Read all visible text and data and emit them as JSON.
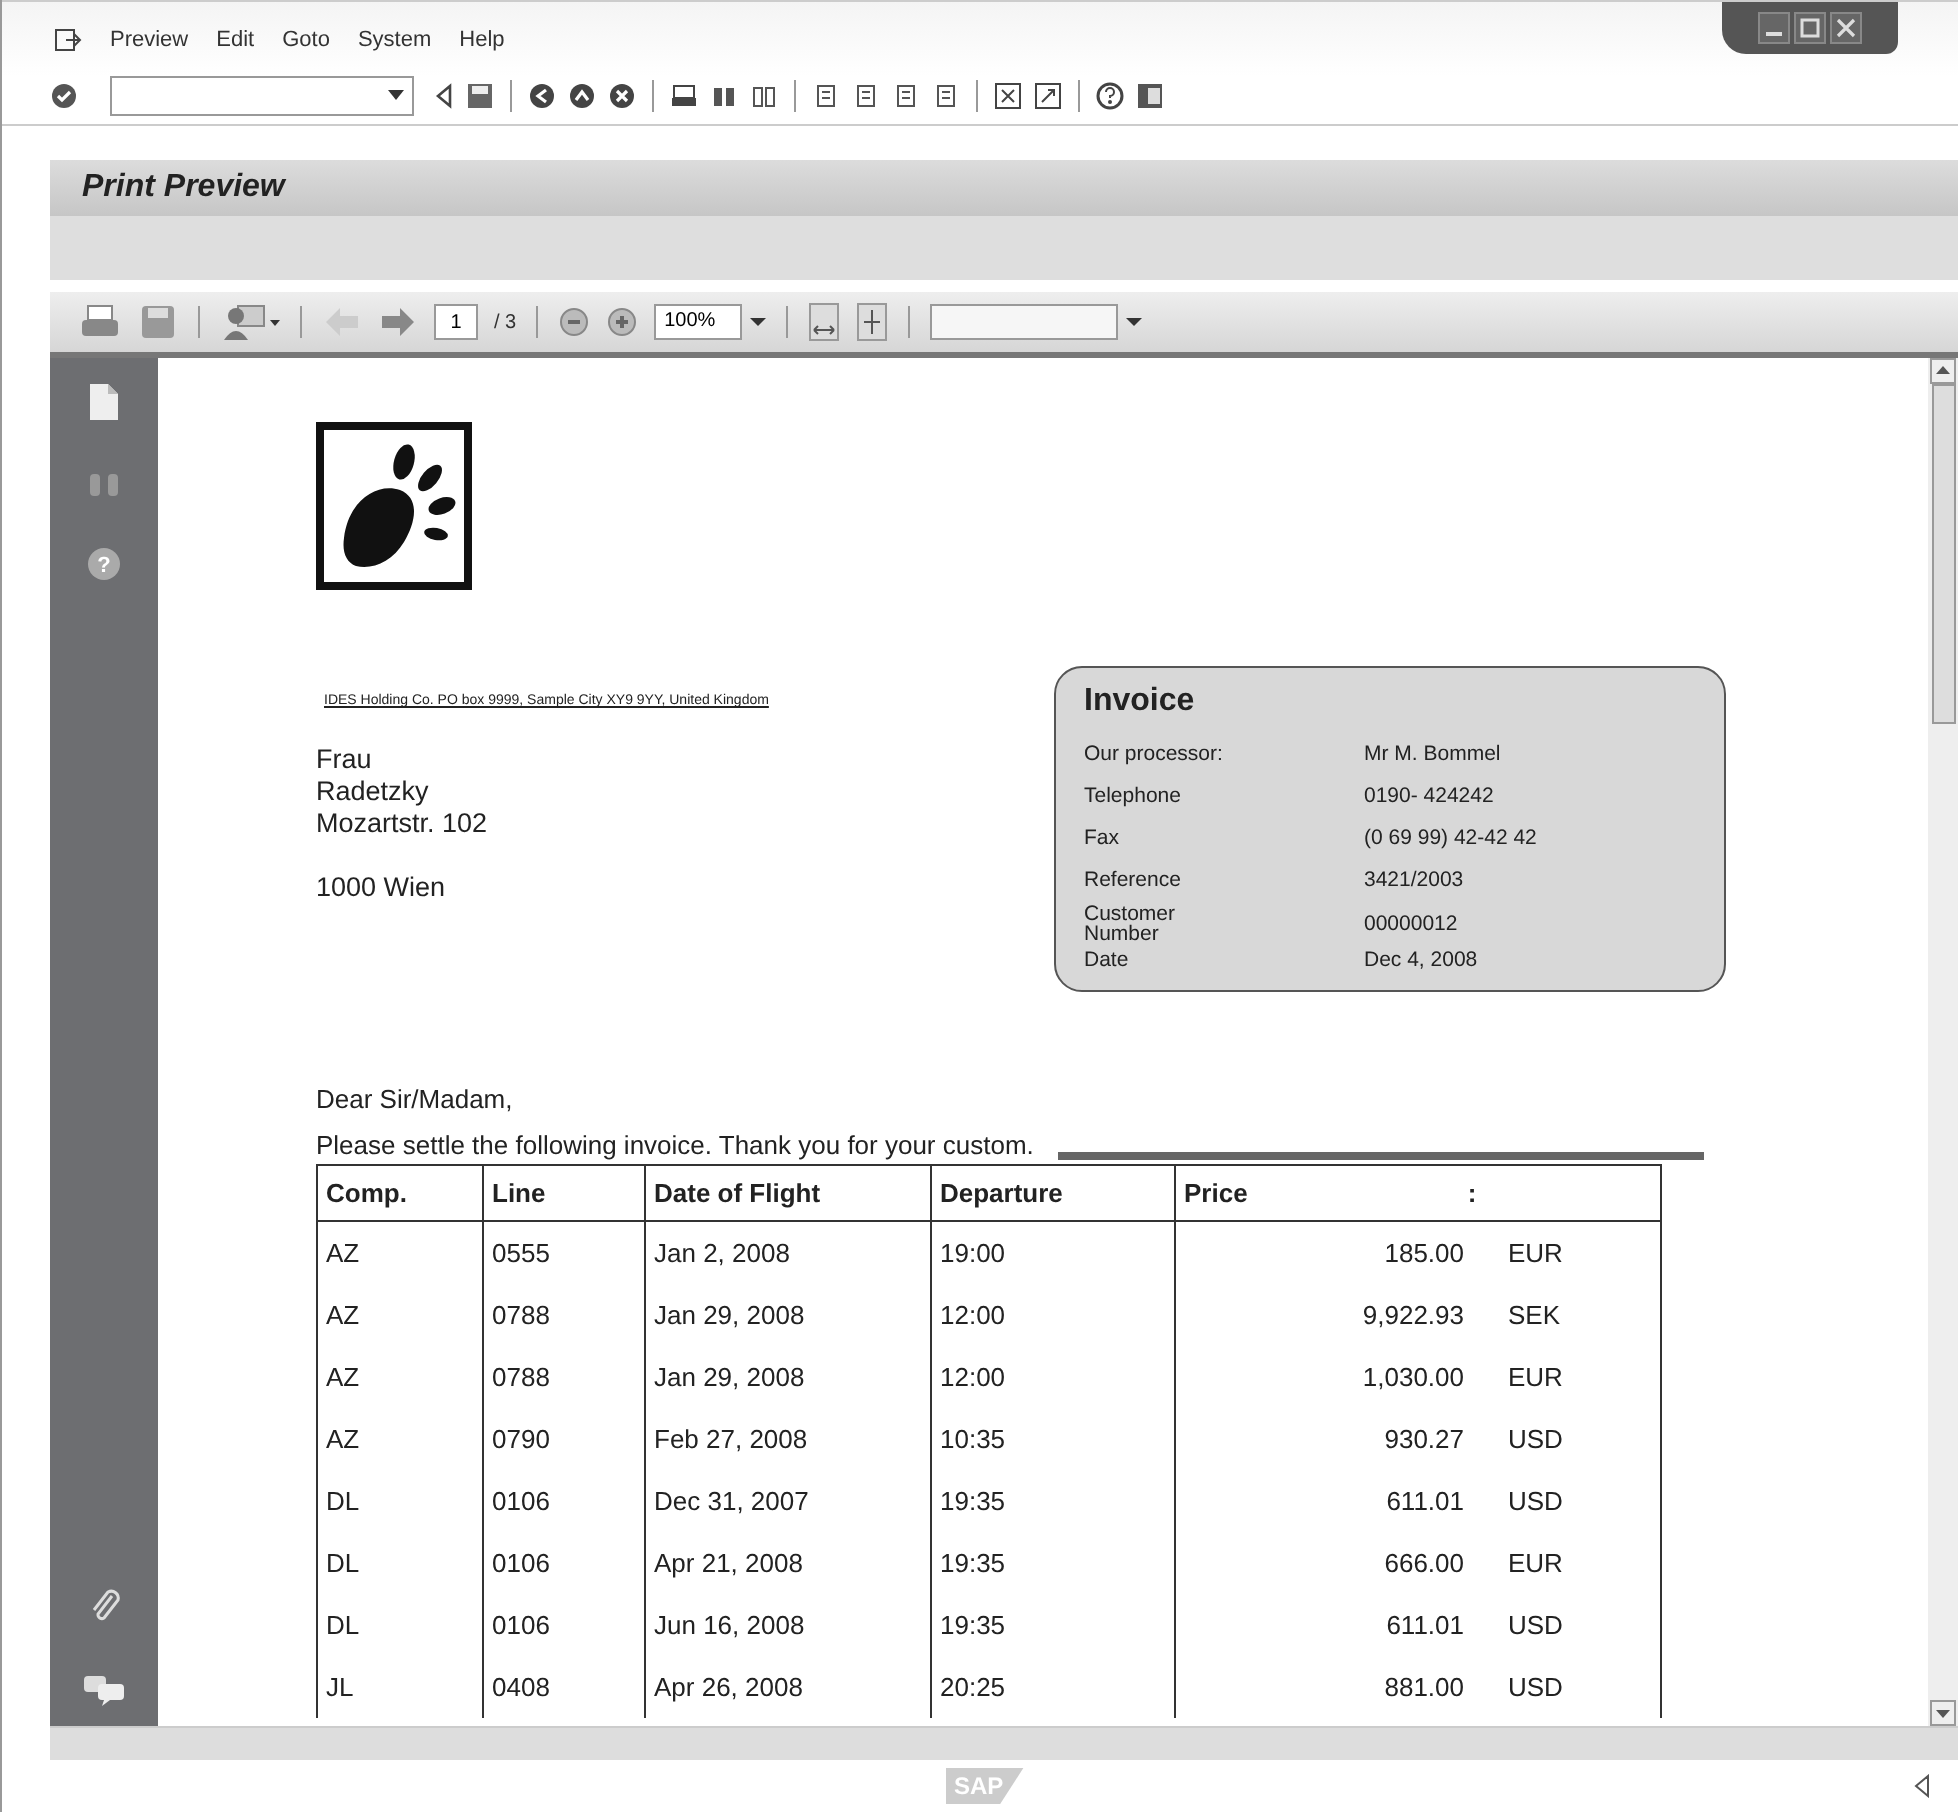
{
  "menu": [
    "Preview",
    "Edit",
    "Goto",
    "System",
    "Help"
  ],
  "screen_title": "Print Preview",
  "pdf_toolbar": {
    "page": "1",
    "page_total": "/ 3",
    "zoom": "100%"
  },
  "sidebar": {
    "help_glyph": "?"
  },
  "document": {
    "sender_line": "IDES Holding Co. PO box 9999, Sample City XY9 9YY, United Kingdom",
    "address": [
      "Frau",
      "Radetzky",
      "Mozartstr. 102"
    ],
    "city": "1000 Wien",
    "invoice": {
      "title": "Invoice",
      "fields": [
        {
          "label": "Our processor:",
          "value": "Mr M. Bommel"
        },
        {
          "label": "Telephone",
          "value": "0190- 424242"
        },
        {
          "label": "Fax",
          "value": "(0 69 99) 42-42 42"
        },
        {
          "label": "Reference",
          "value": "3421/2003"
        },
        {
          "label": "Customer Number",
          "value": "00000012"
        },
        {
          "label": "Date",
          "value": "Dec 4, 2008"
        }
      ]
    },
    "greeting": "Dear Sir/Madam,",
    "body": "Please settle the following invoice. Thank you for your custom.",
    "table": {
      "columns": [
        "Comp.",
        "Line",
        "Date of Flight",
        "Departure",
        "Price"
      ],
      "price_header_colon": ":",
      "rows": [
        {
          "comp": "AZ",
          "line": "0555",
          "date": "Jan 2, 2008",
          "departure": "19:00",
          "amount": "185.00",
          "currency": "EUR"
        },
        {
          "comp": "AZ",
          "line": "0788",
          "date": "Jan 29, 2008",
          "departure": "12:00",
          "amount": "9,922.93",
          "currency": "SEK"
        },
        {
          "comp": "AZ",
          "line": "0788",
          "date": "Jan 29, 2008",
          "departure": "12:00",
          "amount": "1,030.00",
          "currency": "EUR"
        },
        {
          "comp": "AZ",
          "line": "0790",
          "date": "Feb 27, 2008",
          "departure": "10:35",
          "amount": "930.27",
          "currency": "USD"
        },
        {
          "comp": "DL",
          "line": "0106",
          "date": "Dec 31, 2007",
          "departure": "19:35",
          "amount": "611.01",
          "currency": "USD"
        },
        {
          "comp": "DL",
          "line": "0106",
          "date": "Apr 21, 2008",
          "departure": "19:35",
          "amount": "666.00",
          "currency": "EUR"
        },
        {
          "comp": "DL",
          "line": "0106",
          "date": "Jun 16, 2008",
          "departure": "19:35",
          "amount": "611.01",
          "currency": "USD"
        },
        {
          "comp": "JL",
          "line": "0408",
          "date": "Apr 26, 2008",
          "departure": "20:25",
          "amount": "881.00",
          "currency": "USD"
        }
      ]
    }
  },
  "status_bar": {
    "logo": "SAP"
  }
}
